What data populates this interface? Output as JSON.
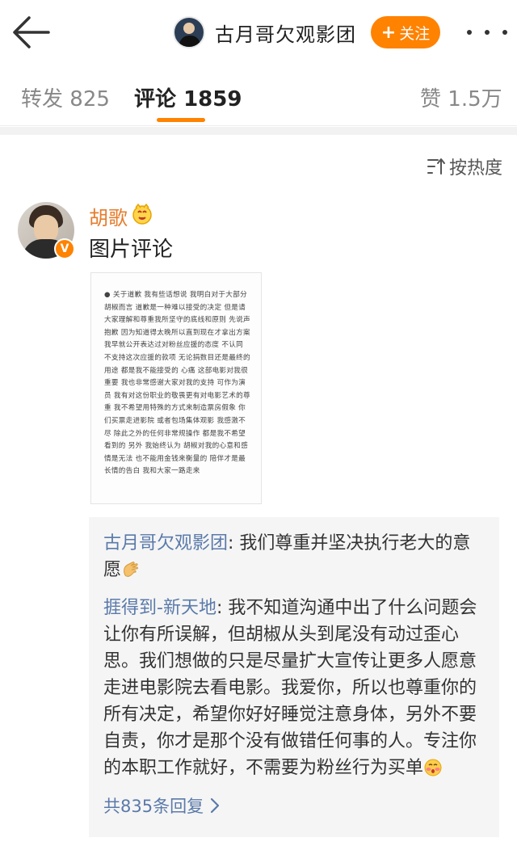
{
  "header": {
    "title": "古月哥欠观影团",
    "follow_label": "关注",
    "follow_plus": "+"
  },
  "tabs": [
    {
      "label": "转发",
      "count": "825"
    },
    {
      "label": "评论",
      "count": "1859"
    },
    {
      "label": "赞",
      "count": "1.5万"
    }
  ],
  "sort": {
    "label": "按热度"
  },
  "comment": {
    "username": "胡歌",
    "badge": "V",
    "text": "图片评论",
    "image_text": "● 关于道歉 我有些话想说 我明白对于大部分胡椒而言 道歉是一种难以接受的决定 但是请大家理解和尊重我所坚守的底线和原则 先说声抱歉 因为知道得太晚所以直到现在才拿出方案 我早就公开表达过对粉丝应援的态度 不认同 不支持这次应援的款项 无论捐数目还是最终的用途 都是我不能接受的 心痛 这部电影对我很重要 我也非常感谢大家对我的支持 可作为演员 我有对这份职业的敬畏更有对电影艺术的尊重 我不希望用特殊的方式来制造票房假象 你们买票走进影院 或者包场集体观影 我感激不尽 除此之外的任何非常规操作 都是我不希望看到的 另外 我始终认为 胡椒对我的心意和感情是无法 也不能用金钱来衡量的 陪伴才是最长情的告白 我和大家一路走来"
  },
  "replies": [
    {
      "name": "古月哥欠观影团",
      "separator": ": ",
      "text": "我们尊重并坚决执行老大的意愿",
      "emoji": "clap-hands-emoji"
    },
    {
      "name": "捱得到-新天地",
      "separator": ": ",
      "text": "我不知道沟通中出了什么问题会让你有所误解，但胡椒从头到尾没有动过歪心思。我们想做的只是尽量扩大宣传让更多人愿意走进电影院去看电影。我爱你，所以也尊重你的所有决定，希望你好好睡觉注意身体，另外不要自责，你才是那个没有做错任何事的人。专注你的本职工作就好，不需要为粉丝行为买单",
      "emoji": "blush-face-emoji"
    }
  ],
  "more_replies": {
    "label": "共835条回复"
  },
  "colors": {
    "accent": "#ff8200",
    "link": "#5a7aaa",
    "username": "#e57d2e"
  }
}
